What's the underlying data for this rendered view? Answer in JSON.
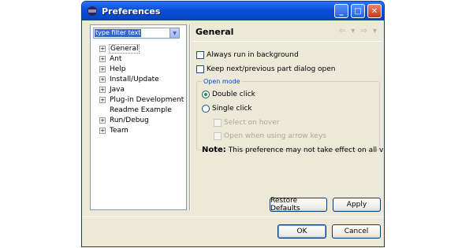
{
  "window": {
    "title": "Preferences"
  },
  "titlebar": {
    "minimize": "_",
    "maximize": "□",
    "close": "✕"
  },
  "filter": {
    "value": "type filter text"
  },
  "tree": {
    "items": [
      {
        "label": "General",
        "expandable": true
      },
      {
        "label": "Ant",
        "expandable": true
      },
      {
        "label": "Help",
        "expandable": true
      },
      {
        "label": "Install/Update",
        "expandable": true
      },
      {
        "label": "Java",
        "expandable": true
      },
      {
        "label": "Plug-in Development",
        "expandable": true
      },
      {
        "label": "Readme Example",
        "expandable": false
      },
      {
        "label": "Run/Debug",
        "expandable": true
      },
      {
        "label": "Team",
        "expandable": true
      }
    ],
    "expander_symbol": "+"
  },
  "page": {
    "title": "General",
    "nav_arrows": "⇦ ▾ ⇨ ▾",
    "always_run_background": "Always run in background",
    "keep_next_prev": "Keep next/previous part dialog open",
    "open_mode": {
      "title": "Open mode",
      "double_click": "Double click",
      "single_click": "Single click",
      "select_on_hover": "Select on hover",
      "open_when_arrow": "Open when using arrow keys"
    },
    "note_label": "Note:",
    "note_text": "This preference may not take effect on all views"
  },
  "buttons": {
    "restore_defaults": "Restore Defaults",
    "apply": "Apply",
    "ok": "OK",
    "cancel": "Cancel"
  },
  "colors": {
    "titlebar": "#0a4fd8",
    "dialog_bg": "#ece9d8",
    "selection": "#316ac5"
  }
}
